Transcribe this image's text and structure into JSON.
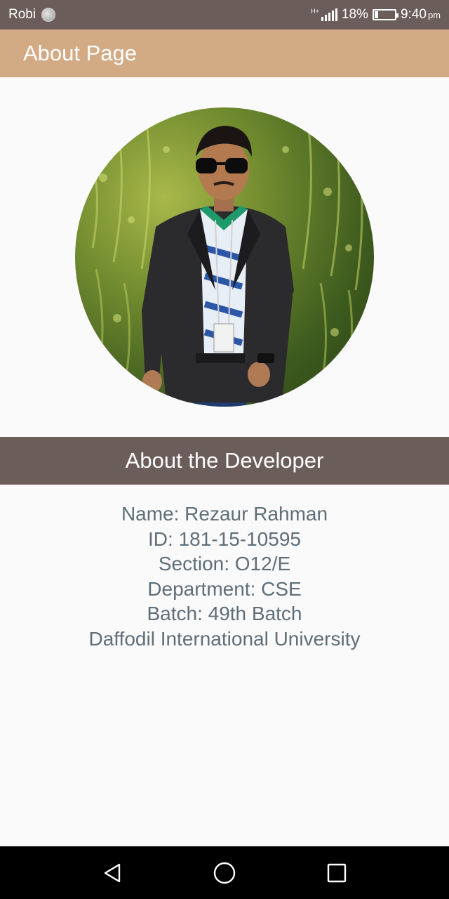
{
  "status_bar": {
    "carrier": "Robi",
    "network_tag": "H+",
    "battery_percent": "18%",
    "battery_level": 0.18,
    "time": "9:40",
    "ampm": "pm"
  },
  "app_bar": {
    "title": "About Page"
  },
  "profile": {
    "photo_icon": "person-photo"
  },
  "section": {
    "title": "About the Developer"
  },
  "developer": {
    "name": "Name: Rezaur Rahman",
    "id": "ID: 181-15-10595",
    "section": "Section: O12/E",
    "department": "Department: CSE",
    "batch": "Batch: 49th Batch",
    "university": "Daffodil International University"
  },
  "nav": {
    "back_icon": "back-triangle-icon",
    "home_icon": "home-circle-icon",
    "recents_icon": "recents-square-icon"
  },
  "colors": {
    "status_bar": "#6b5d5a",
    "app_bar": "#d2ab85",
    "section_header": "#6b5d5a",
    "info_text": "#5f6e78",
    "background": "#fafafa"
  }
}
